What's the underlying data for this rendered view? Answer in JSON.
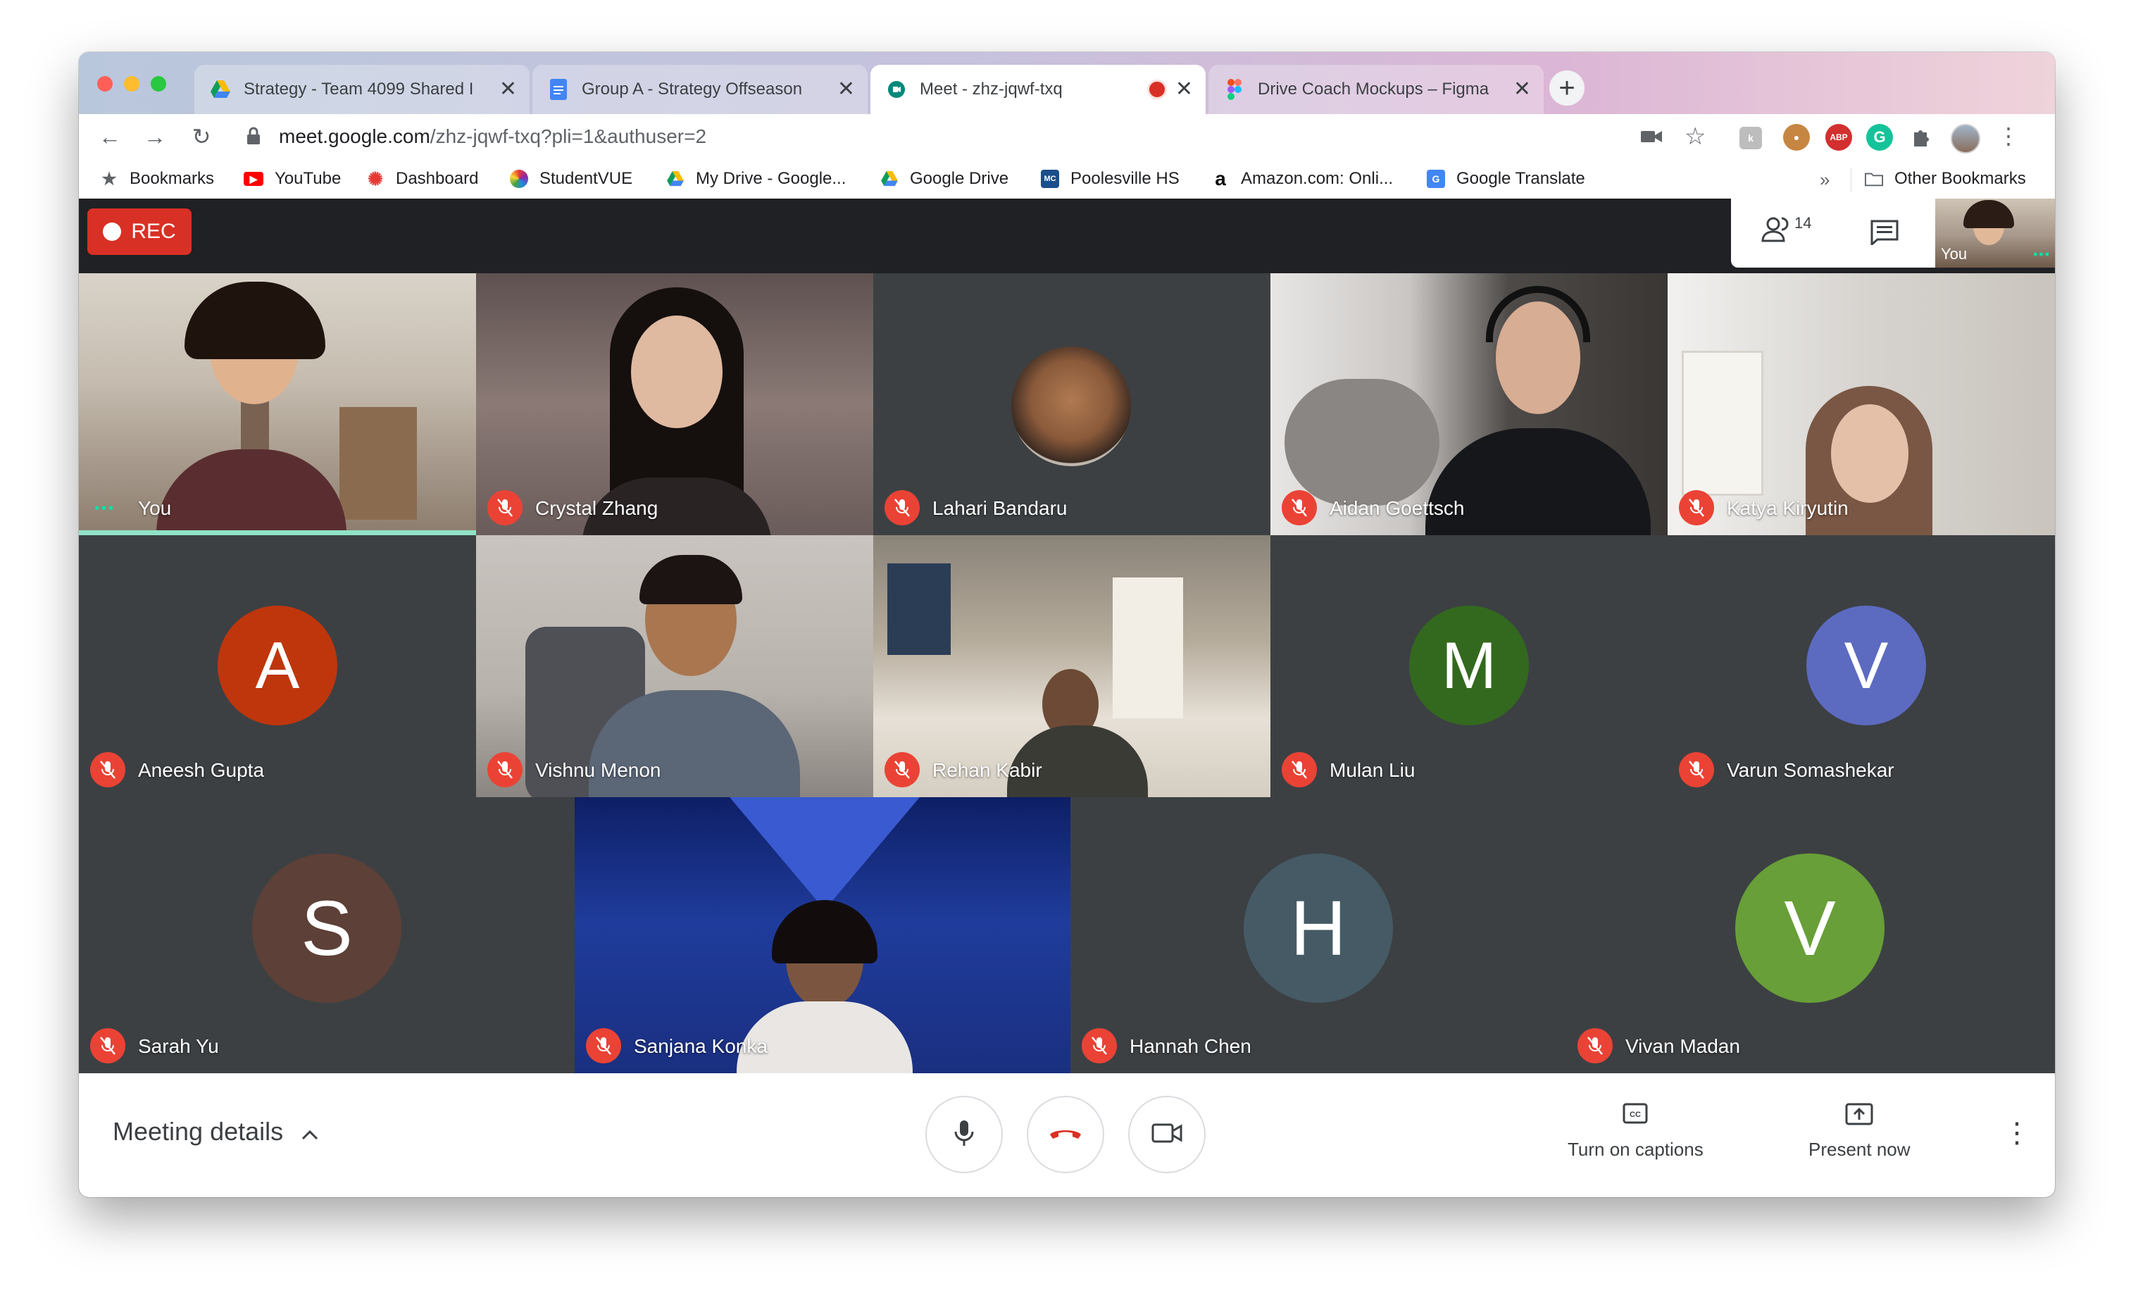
{
  "browser": {
    "tabs": [
      {
        "title": "Strategy - Team 4099 Shared I",
        "icon": "google-drive-icon",
        "active": false
      },
      {
        "title": "Group A - Strategy Offseason",
        "icon": "google-docs-icon",
        "active": false
      },
      {
        "title": "Meet - zhz-jqwf-txq",
        "icon": "google-meet-icon",
        "active": true,
        "recording": true
      },
      {
        "title": "Drive Coach Mockups – Figma",
        "icon": "figma-icon",
        "active": false
      }
    ],
    "url": {
      "host": "meet.google.com",
      "path": "/zhz-jqwf-txq?pli=1&authuser=2"
    },
    "bookmarks": [
      {
        "label": "Bookmarks",
        "icon": "star-icon"
      },
      {
        "label": "YouTube",
        "icon": "youtube-icon"
      },
      {
        "label": "Dashboard",
        "icon": "dashboard-icon"
      },
      {
        "label": "StudentVUE",
        "icon": "studentvue-icon"
      },
      {
        "label": "My Drive - Google...",
        "icon": "google-drive-icon"
      },
      {
        "label": "Google Drive",
        "icon": "google-drive-icon"
      },
      {
        "label": "Poolesville HS",
        "icon": "mcps-icon"
      },
      {
        "label": "Amazon.com: Onli...",
        "icon": "amazon-icon"
      },
      {
        "label": "Google Translate",
        "icon": "google-translate-icon"
      }
    ],
    "bookmarks_overflow": "»",
    "other_bookmarks": "Other Bookmarks",
    "extensions": {
      "abp": "ABP",
      "grammarly": "G"
    }
  },
  "meet": {
    "rec_label": "REC",
    "participant_count": "14",
    "self_preview_label": "You",
    "participants": [
      {
        "name": "You",
        "muted": false,
        "video": true
      },
      {
        "name": "Crystal Zhang",
        "muted": true,
        "video": true
      },
      {
        "name": "Lahari Bandaru",
        "muted": true,
        "video": false
      },
      {
        "name": "Aidan Goettsch",
        "muted": true,
        "video": true
      },
      {
        "name": "Katya Kiryutin",
        "muted": true,
        "video": true
      },
      {
        "name": "Aneesh Gupta",
        "muted": true,
        "initial": "A",
        "color": "#bf360c"
      },
      {
        "name": "Vishnu Menon",
        "muted": true,
        "video": true
      },
      {
        "name": "Rehan Kabir",
        "muted": true,
        "video": true
      },
      {
        "name": "Mulan Liu",
        "muted": true,
        "initial": "M",
        "color": "#33691e"
      },
      {
        "name": "Varun Somashekar",
        "muted": true,
        "initial": "V",
        "color": "#5c6bc0"
      },
      {
        "name": "Sarah Yu",
        "muted": true,
        "initial": "S",
        "color": "#5d4037"
      },
      {
        "name": "Sanjana Konka",
        "muted": true,
        "video": true
      },
      {
        "name": "Hannah Chen",
        "muted": true,
        "initial": "H",
        "color": "#455a64"
      },
      {
        "name": "Vivan Madan",
        "muted": true,
        "initial": "V",
        "color": "#689f38"
      }
    ],
    "bottom": {
      "meeting_details": "Meeting details",
      "captions": "Turn on captions",
      "present": "Present now"
    }
  }
}
